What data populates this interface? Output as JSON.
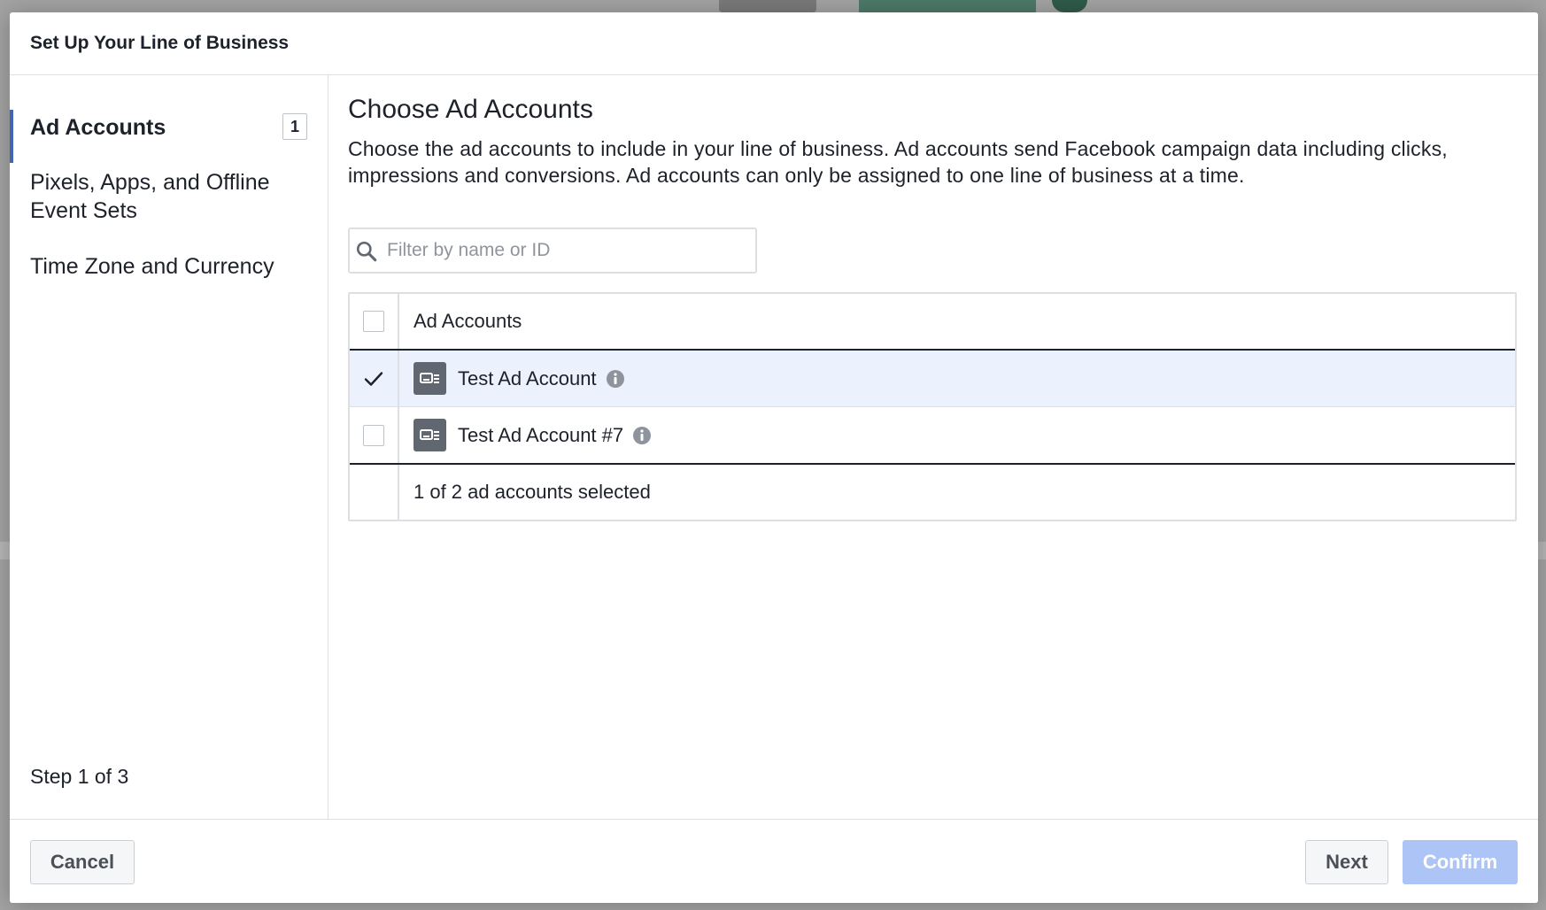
{
  "modal": {
    "title": "Set Up Your Line of Business"
  },
  "sidebar": {
    "items": [
      {
        "label": "Ad Accounts",
        "badge": "1",
        "active": true
      },
      {
        "label": "Pixels, Apps, and Offline Event Sets"
      },
      {
        "label": "Time Zone and Currency"
      }
    ],
    "step_text": "Step 1 of 3"
  },
  "main": {
    "title": "Choose Ad Accounts",
    "description": "Choose the ad accounts to include in your line of business. Ad accounts send Facebook campaign data including clicks, impressions and conversions. Ad accounts can only be assigned to one line of business at a time.",
    "search": {
      "placeholder": "Filter by name or ID",
      "value": ""
    },
    "table": {
      "header": "Ad Accounts",
      "rows": [
        {
          "name": "Test Ad Account",
          "checked": true,
          "icon": "ad-account-icon"
        },
        {
          "name": "Test Ad Account #7",
          "checked": false,
          "icon": "ad-account-icon"
        }
      ],
      "footer": "1 of 2 ad accounts selected"
    }
  },
  "footer": {
    "cancel_label": "Cancel",
    "next_label": "Next",
    "confirm_label": "Confirm"
  },
  "colors": {
    "accent": "#4267b2",
    "selected_row": "#ebf2fd",
    "confirm_disabled": "#adc4f7",
    "icon_gray": "#606770"
  }
}
